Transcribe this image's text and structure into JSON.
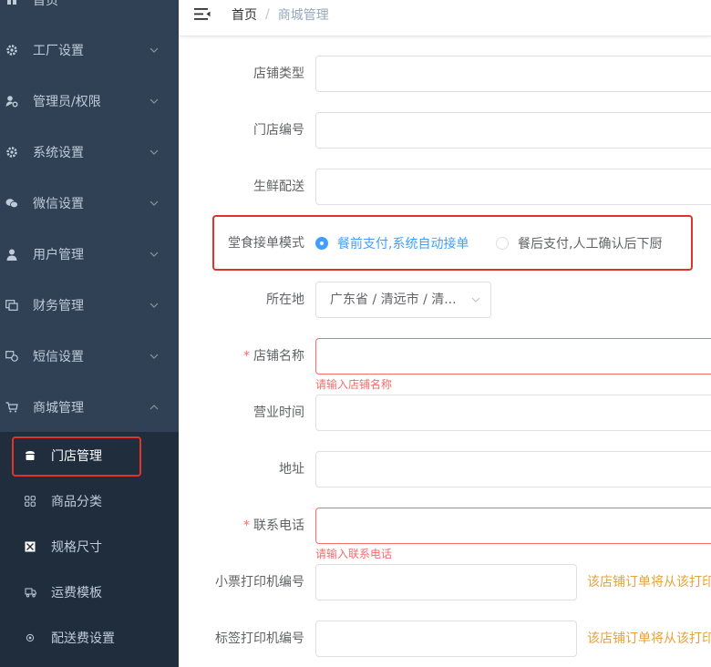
{
  "sidebar": {
    "top_item": {
      "label": "首页",
      "icon": "home-icon"
    },
    "items": [
      {
        "label": "工厂设置",
        "icon": "gear-icon"
      },
      {
        "label": "管理员/权限",
        "icon": "user-key-icon"
      },
      {
        "label": "系统设置",
        "icon": "gear-icon"
      },
      {
        "label": "微信设置",
        "icon": "wechat-icon"
      },
      {
        "label": "用户管理",
        "icon": "user-icon"
      },
      {
        "label": "财务管理",
        "icon": "finance-icon"
      },
      {
        "label": "短信设置",
        "icon": "sms-icon"
      },
      {
        "label": "商城管理",
        "icon": "cart-icon"
      }
    ],
    "submenu": [
      {
        "label": "门店管理",
        "icon": "store-icon",
        "active": true
      },
      {
        "label": "商品分类",
        "icon": "grid-icon"
      },
      {
        "label": "规格尺寸",
        "icon": "size-icon"
      },
      {
        "label": "运费模板",
        "icon": "truck-icon"
      },
      {
        "label": "配送费设置",
        "icon": "delivery-icon"
      }
    ]
  },
  "header": {
    "breadcrumb": {
      "home": "首页",
      "separator": "/",
      "current": "商城管理"
    }
  },
  "form": {
    "store_type": {
      "label": "店铺类型",
      "value": ""
    },
    "store_code": {
      "label": "门店编号",
      "value": ""
    },
    "fresh_delivery": {
      "label": "生鲜配送",
      "value": ""
    },
    "dine_mode": {
      "label": "堂食接单模式",
      "options": [
        "餐前支付,系统自动接单",
        "餐后支付,人工确认后下厨"
      ],
      "selected": 0
    },
    "location": {
      "label": "所在地",
      "value": "广东省 / 清远市 / 清..."
    },
    "store_name": {
      "label": "店铺名称",
      "value": "",
      "required": "*",
      "error": "请输入店铺名称"
    },
    "business_hours": {
      "label": "营业时间",
      "value": ""
    },
    "address": {
      "label": "地址",
      "value": ""
    },
    "phone": {
      "label": "联系电话",
      "value": "",
      "required": "*",
      "error": "请输入联系电话"
    },
    "receipt_printer": {
      "label": "小票打印机编号",
      "value": "",
      "hint": "该店铺订单将从该打印"
    },
    "label_printer": {
      "label": "标签打印机编号",
      "value": "",
      "hint": "该店铺订单将从该打印"
    }
  },
  "colors": {
    "sidebar_bg": "#304156",
    "submenu_bg": "#1f2d3d",
    "primary": "#409eff",
    "error": "#f56c6c",
    "warning": "#e6a23c",
    "highlight": "#e0342b"
  }
}
